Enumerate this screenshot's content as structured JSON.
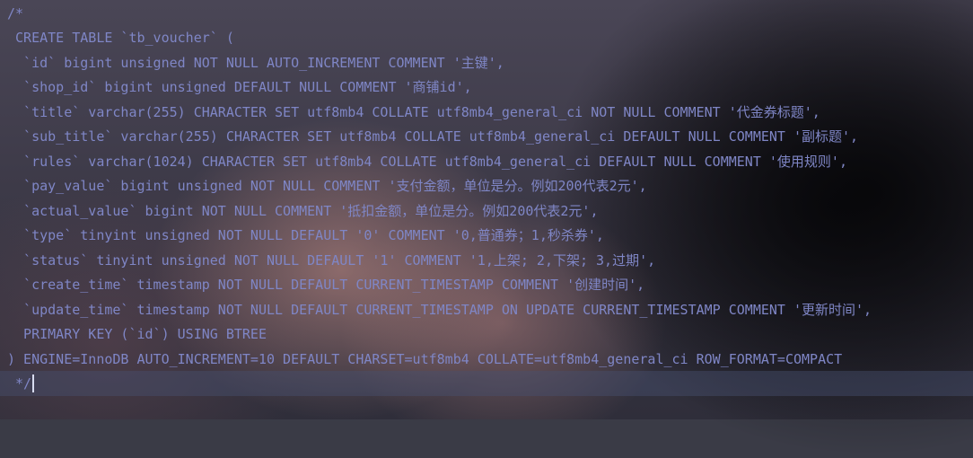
{
  "editor": {
    "lines": [
      "/*",
      " CREATE TABLE `tb_voucher` (",
      "  `id` bigint unsigned NOT NULL AUTO_INCREMENT COMMENT '主键',",
      "  `shop_id` bigint unsigned DEFAULT NULL COMMENT '商铺id',",
      "  `title` varchar(255) CHARACTER SET utf8mb4 COLLATE utf8mb4_general_ci NOT NULL COMMENT '代金券标题',",
      "  `sub_title` varchar(255) CHARACTER SET utf8mb4 COLLATE utf8mb4_general_ci DEFAULT NULL COMMENT '副标题',",
      "  `rules` varchar(1024) CHARACTER SET utf8mb4 COLLATE utf8mb4_general_ci DEFAULT NULL COMMENT '使用规则',",
      "  `pay_value` bigint unsigned NOT NULL COMMENT '支付金额，单位是分。例如200代表2元',",
      "  `actual_value` bigint NOT NULL COMMENT '抵扣金额，单位是分。例如200代表2元',",
      "  `type` tinyint unsigned NOT NULL DEFAULT '0' COMMENT '0,普通券；1,秒杀券',",
      "  `status` tinyint unsigned NOT NULL DEFAULT '1' COMMENT '1,上架; 2,下架; 3,过期',",
      "  `create_time` timestamp NOT NULL DEFAULT CURRENT_TIMESTAMP COMMENT '创建时间',",
      "  `update_time` timestamp NOT NULL DEFAULT CURRENT_TIMESTAMP ON UPDATE CURRENT_TIMESTAMP COMMENT '更新时间',",
      "  PRIMARY KEY (`id`) USING BTREE",
      ") ENGINE=InnoDB AUTO_INCREMENT=10 DEFAULT CHARSET=utf8mb4 COLLATE=utf8mb4_general_ci ROW_FORMAT=COMPACT",
      " */"
    ]
  },
  "colors": {
    "comment_text": "#7f86c6",
    "caret": "#d8dcf0"
  }
}
